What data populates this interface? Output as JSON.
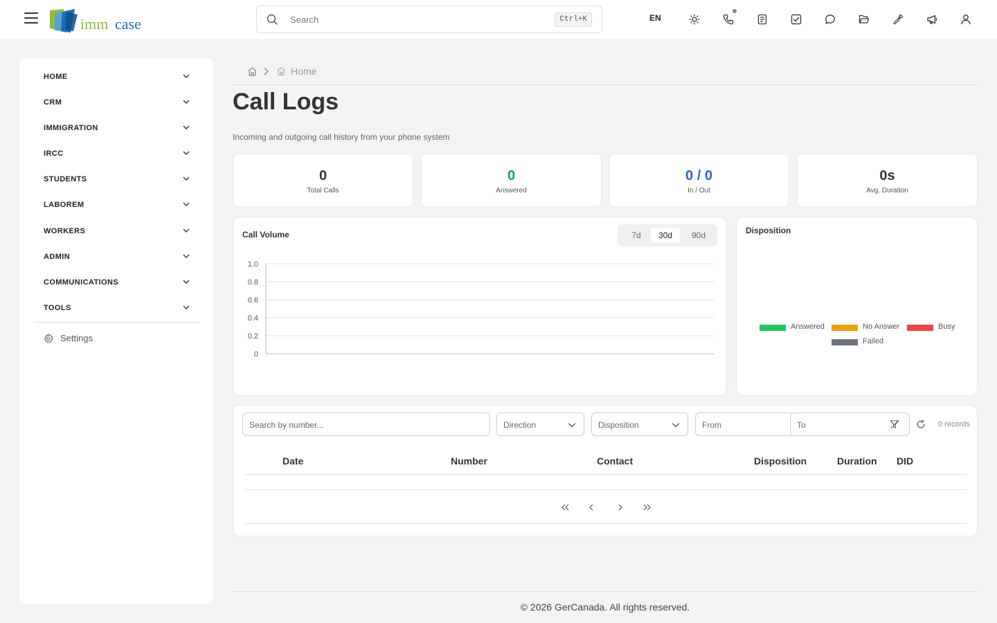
{
  "header": {
    "logo_imm": "imm",
    "logo_case": "case",
    "search_placeholder": "Search",
    "search_shortcut": "Ctrl+K",
    "language": "EN",
    "icons": [
      "sun-icon",
      "phone-icon",
      "notes-icon",
      "tasks-icon",
      "chat-icon",
      "folder-icon",
      "wrench-icon",
      "megaphone-icon",
      "user-icon"
    ]
  },
  "sidebar": {
    "items": [
      {
        "label": "HOME"
      },
      {
        "label": "CRM"
      },
      {
        "label": "IMMIGRATION"
      },
      {
        "label": "IRCC"
      },
      {
        "label": "STUDENTS"
      },
      {
        "label": "LABOREM"
      },
      {
        "label": "WORKERS"
      },
      {
        "label": "ADMIN"
      },
      {
        "label": "COMMUNICATIONS"
      },
      {
        "label": "TOOLS"
      }
    ],
    "settings_label": "Settings"
  },
  "breadcrumb": {
    "current": "Home"
  },
  "page": {
    "title": "Call Logs",
    "subtitle": "Incoming and outgoing call history from your phone system"
  },
  "stats": [
    {
      "value": "0",
      "label": "Total Calls",
      "color": "#333333"
    },
    {
      "value": "0",
      "label": "Answered",
      "color": "#16a34a"
    },
    {
      "value": "0 / 0",
      "label": "In / Out",
      "color": "#2563eb"
    },
    {
      "value": "0s",
      "label": "Avg. Duration",
      "color": "#333333"
    }
  ],
  "call_volume": {
    "title": "Call Volume",
    "ranges": [
      "7d",
      "30d",
      "90d"
    ],
    "active_range": "30d"
  },
  "disposition": {
    "title": "Disposition",
    "legend": [
      {
        "label": "Answered",
        "color": "#22c55e"
      },
      {
        "label": "No Answer",
        "color": "#f59e0b"
      },
      {
        "label": "Busy",
        "color": "#ef4444"
      },
      {
        "label": "Failed",
        "color": "#6b7280"
      }
    ]
  },
  "chart_data": {
    "type": "line",
    "title": "Call Volume",
    "xlabel": "",
    "ylabel": "",
    "ylim": [
      0,
      1
    ],
    "yticks": [
      "0",
      "0.2",
      "0.4",
      "0.6",
      "0.8",
      "1.0"
    ],
    "series": [],
    "grid": true
  },
  "filters": {
    "search_placeholder": "Search by number...",
    "direction": "Direction",
    "disposition": "Disposition",
    "from": "From",
    "to": "To",
    "records": "0 records"
  },
  "table": {
    "columns": [
      "Date",
      "Number",
      "Contact",
      "Disposition",
      "Duration",
      "DID"
    ],
    "rows": []
  },
  "footer": {
    "text": "© 2026 GerCanada. All rights reserved."
  }
}
